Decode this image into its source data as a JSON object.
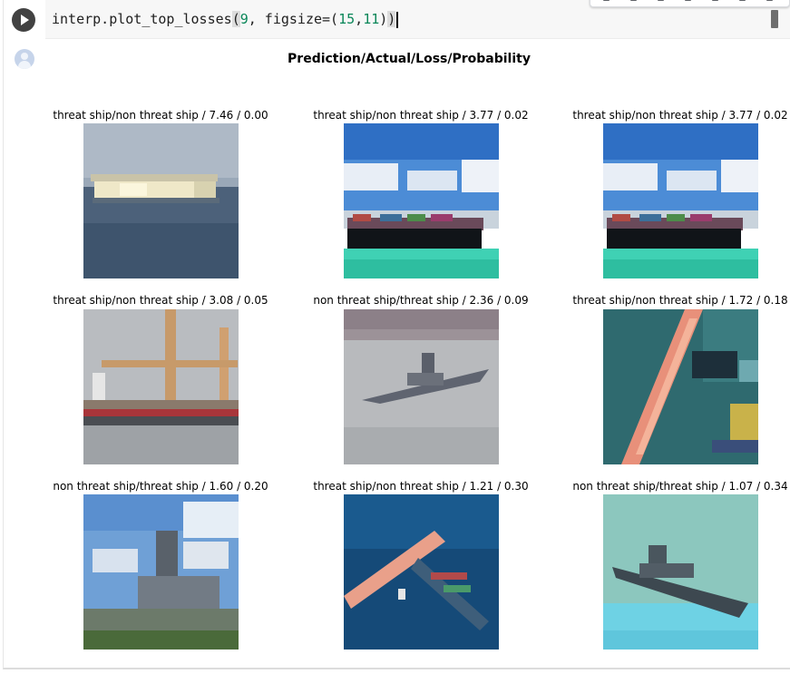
{
  "code_cell": {
    "code_fn": "interp.plot_top_losses",
    "code_arg1": "9",
    "code_sep": ", figsize=(",
    "code_arg2": "15",
    "code_arg3": "11"
  },
  "figure": {
    "title": "Prediction/Actual/Loss/Probability",
    "tiles": [
      {
        "label": "threat ship/non threat ship / 7.46 / 0.00"
      },
      {
        "label": "threat ship/non threat ship / 3.77 / 0.02"
      },
      {
        "label": "threat ship/non threat ship / 3.77 / 0.02"
      },
      {
        "label": "threat ship/non threat ship / 3.08 / 0.05"
      },
      {
        "label": "non threat ship/threat ship / 2.36 / 0.09"
      },
      {
        "label": "threat ship/non threat ship / 1.72 / 0.18"
      },
      {
        "label": "non threat ship/threat ship / 1.60 / 0.20"
      },
      {
        "label": "threat ship/non threat ship / 1.21 / 0.30"
      },
      {
        "label": "non threat ship/threat ship / 1.07 / 0.34"
      }
    ]
  }
}
